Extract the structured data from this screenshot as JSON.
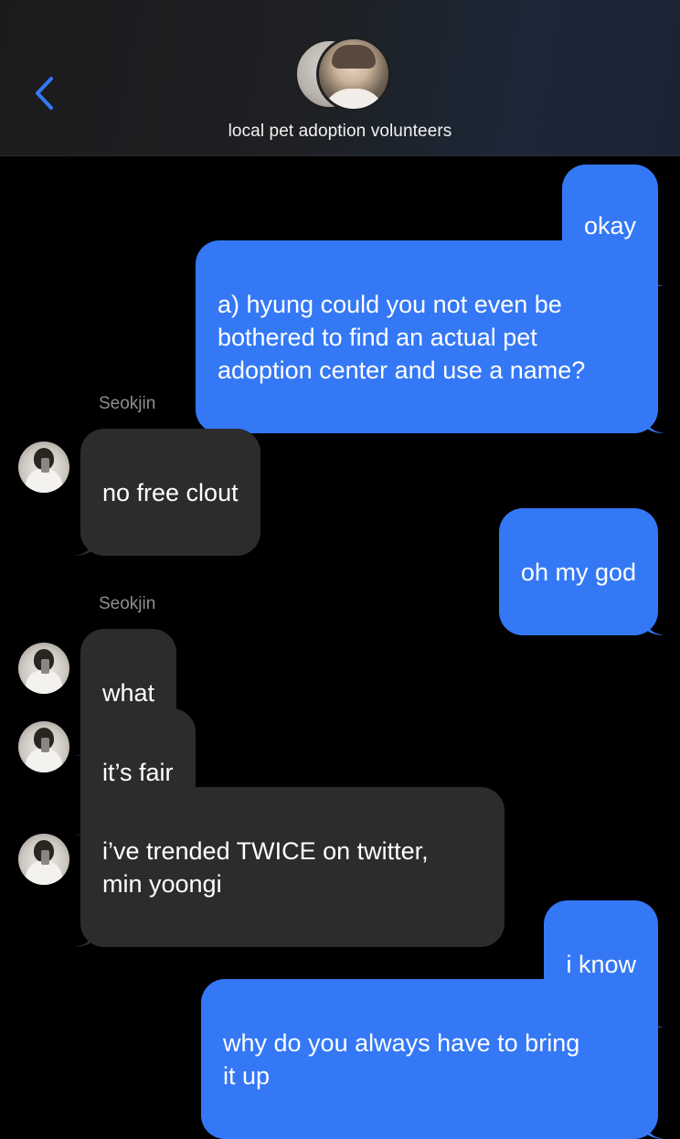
{
  "header": {
    "title": "local pet adoption volunteers",
    "back_icon": "chevron-left-icon"
  },
  "colors": {
    "outgoing_bubble": "#3478f6",
    "incoming_bubble": "#2c2c2e",
    "sender_name": "#8e8e93",
    "accent": "#3478f6"
  },
  "messages": [
    {
      "direction": "out",
      "text": "okay"
    },
    {
      "direction": "out",
      "text": "a) hyung could you not even be\nbothered to find an actual pet\nadoption center and use a name?"
    },
    {
      "direction": "in",
      "sender": "Seokjin",
      "text": "no free clout"
    },
    {
      "direction": "out",
      "text": "oh my god"
    },
    {
      "direction": "in",
      "sender": "Seokjin",
      "text": "what"
    },
    {
      "direction": "in",
      "text": "it’s fair"
    },
    {
      "direction": "in",
      "text": "i’ve trended TWICE on twitter,\nmin yoongi"
    },
    {
      "direction": "out",
      "text": "i know"
    },
    {
      "direction": "out",
      "text": "why do you always have to bring\nit up"
    }
  ]
}
